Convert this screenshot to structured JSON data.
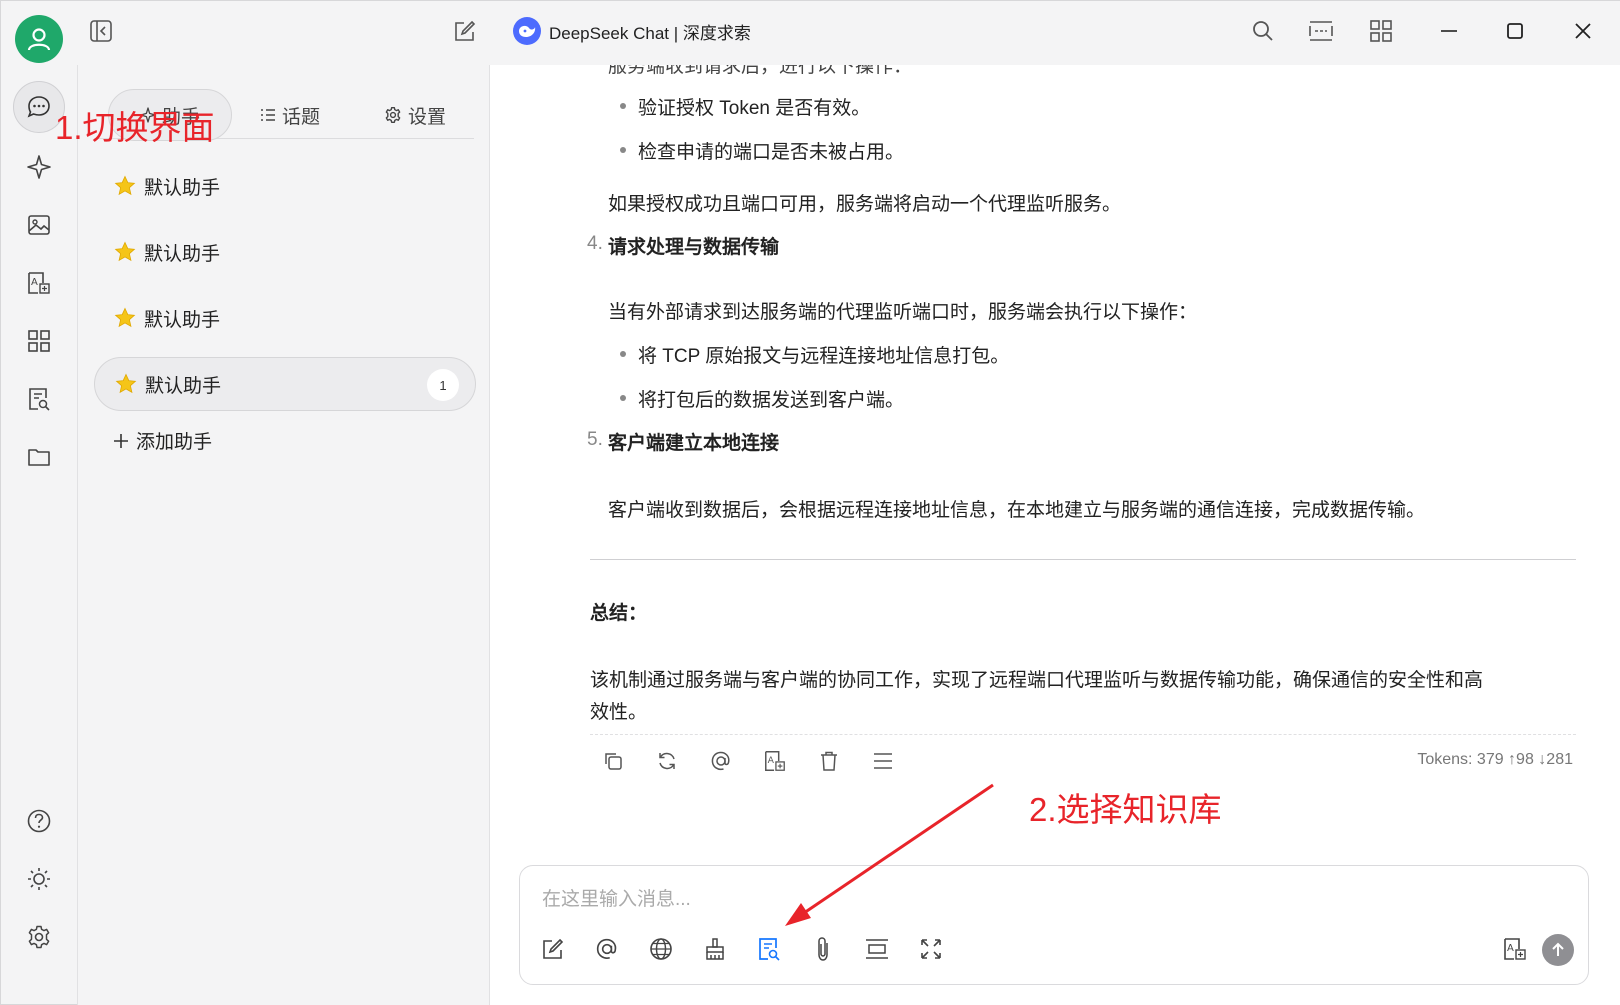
{
  "window": {
    "title": "DeepSeek Chat | 深度求索"
  },
  "panel": {
    "tabs": [
      {
        "label": "助手",
        "icon": "sparkle-icon"
      },
      {
        "label": "话题",
        "icon": "list-icon"
      },
      {
        "label": "设置",
        "icon": "gear-icon"
      }
    ],
    "assistants": [
      {
        "label": "默认助手"
      },
      {
        "label": "默认助手"
      },
      {
        "label": "默认助手"
      },
      {
        "label": "默认助手",
        "badge": "1"
      }
    ],
    "add_label": "添加助手"
  },
  "chat": {
    "partial_top": "服务端收到请求后，进行以下操作：",
    "bullets_a": [
      "验证授权 Token 是否有效。",
      "检查申请的端口是否未被占用。"
    ],
    "para_a": "如果授权成功且端口可用，服务端将启动一个代理监听服务。",
    "step4_num": "4.",
    "step4_title": "请求处理与数据传输",
    "para_b": "当有外部请求到达服务端的代理监听端口时，服务端会执行以下操作：",
    "bullets_b": [
      "将 TCP 原始报文与远程连接地址信息打包。",
      "将打包后的数据发送到客户端。"
    ],
    "step5_num": "5.",
    "step5_title": "客户端建立本地连接",
    "para_c": "客户端收到数据后，会根据远程连接地址信息，在本地建立与服务端的通信连接，完成数据传输。",
    "summary_title": "总结：",
    "summary_line1": "该机制通过服务端与客户端的协同工作，实现了远程端口代理监听与数据传输功能，确保通信的安全性和高",
    "summary_line2": "效性。",
    "tokens": "Tokens: 379 ↑98 ↓281"
  },
  "input": {
    "placeholder": "在这里输入消息..."
  },
  "annotations": {
    "step1": "1.切换界面",
    "step2": "2.选择知识库"
  },
  "colors": {
    "accent": "#1fa86a",
    "annotation": "#e8242a",
    "knowledge_icon": "#1677ff",
    "deepseek": "#4d6bfe",
    "star": "#f5c518"
  }
}
